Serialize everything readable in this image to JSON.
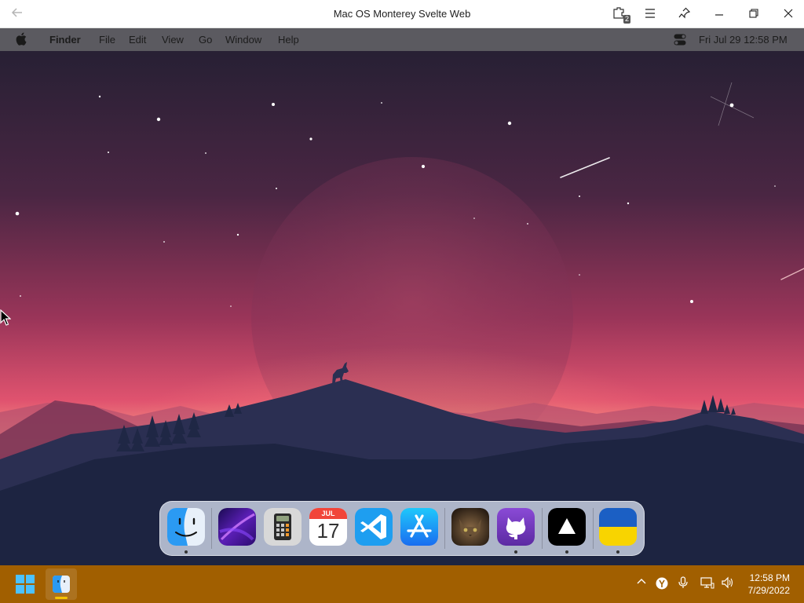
{
  "window": {
    "title": "Mac OS Monterey Svelte Web",
    "extensions_count": "2"
  },
  "menubar": {
    "app_name": "Finder",
    "items": [
      "File",
      "Edit",
      "View",
      "Go",
      "Window",
      "Help"
    ],
    "clock": "Fri Jul 29   12:58 PM"
  },
  "dock": {
    "apps": [
      {
        "name": "finder-icon",
        "running": true
      },
      {
        "name": "launchpad-icon",
        "running": false
      },
      {
        "name": "calculator-icon",
        "running": false
      },
      {
        "name": "calendar-icon",
        "running": false,
        "month": "JUL",
        "day": "17"
      },
      {
        "name": "vscode-icon",
        "running": false
      },
      {
        "name": "app-store-icon",
        "running": false
      },
      {
        "name": "cat-photo-icon",
        "running": false
      },
      {
        "name": "github-icon",
        "running": true
      },
      {
        "name": "vercel-icon",
        "running": true
      },
      {
        "name": "ukraine-flag-icon",
        "running": true
      }
    ]
  },
  "taskbar": {
    "time": "12:58 PM",
    "date": "7/29/2022"
  },
  "colors": {
    "taskbar": "#a15f00",
    "menubar": "#5b5a60",
    "sky_top": "#2a2038",
    "sky_glow": "#e8577a",
    "hills": "#1f2744"
  }
}
